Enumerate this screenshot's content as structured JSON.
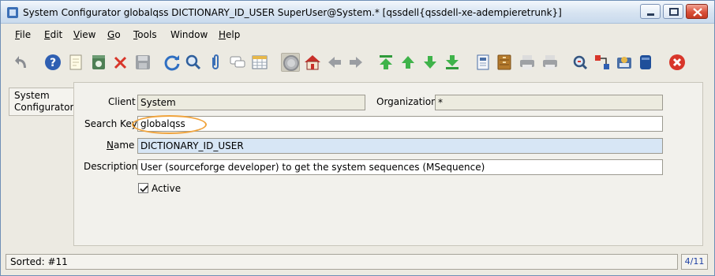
{
  "window": {
    "title": "System Configurator  globalqss  DICTIONARY_ID_USER  SuperUser@System.* [qssdell{qssdell-xe-adempieretrunk}]"
  },
  "menubar": {
    "items": [
      "File",
      "Edit",
      "View",
      "Go",
      "Tools",
      "Window",
      "Help"
    ],
    "mnemonics": [
      "F",
      "E",
      "V",
      "G",
      "T",
      "",
      "H"
    ]
  },
  "toolbar": {
    "icons": [
      "undo-icon",
      "help-icon",
      "new-record-icon",
      "save-copy-icon",
      "delete-icon",
      "save-icon",
      "refresh-icon",
      "find-icon",
      "attachment-icon",
      "chat-icon",
      "grid-toggle-icon",
      "history-icon",
      "home-icon",
      "back-icon",
      "forward-icon",
      "first-record-icon",
      "previous-record-icon",
      "next-record-icon",
      "last-record-icon",
      "report-icon",
      "archive-icon",
      "print-preview-icon",
      "print-icon",
      "zoom-across-icon",
      "active-workflows-icon",
      "requests-icon",
      "product-info-icon",
      "exit-icon"
    ]
  },
  "tabs": {
    "active": "System\nConfigurator"
  },
  "form": {
    "client_label": "Client",
    "client_value": "System",
    "org_label": "Organization",
    "org_value": "*",
    "searchkey_label": "Search Key",
    "searchkey_value": "globalqss",
    "name_label": "Name",
    "name_value": "DICTIONARY_ID_USER",
    "description_label": "Description",
    "description_value": "User (sourceforge developer) to get the system sequences (MSequence)",
    "active_label": "Active",
    "active_checked": true
  },
  "status": {
    "text": "Sorted: #11",
    "record": "4/11"
  },
  "colors": {
    "highlight": "#f0a33c",
    "name_field_bg": "#d7e6f5"
  }
}
